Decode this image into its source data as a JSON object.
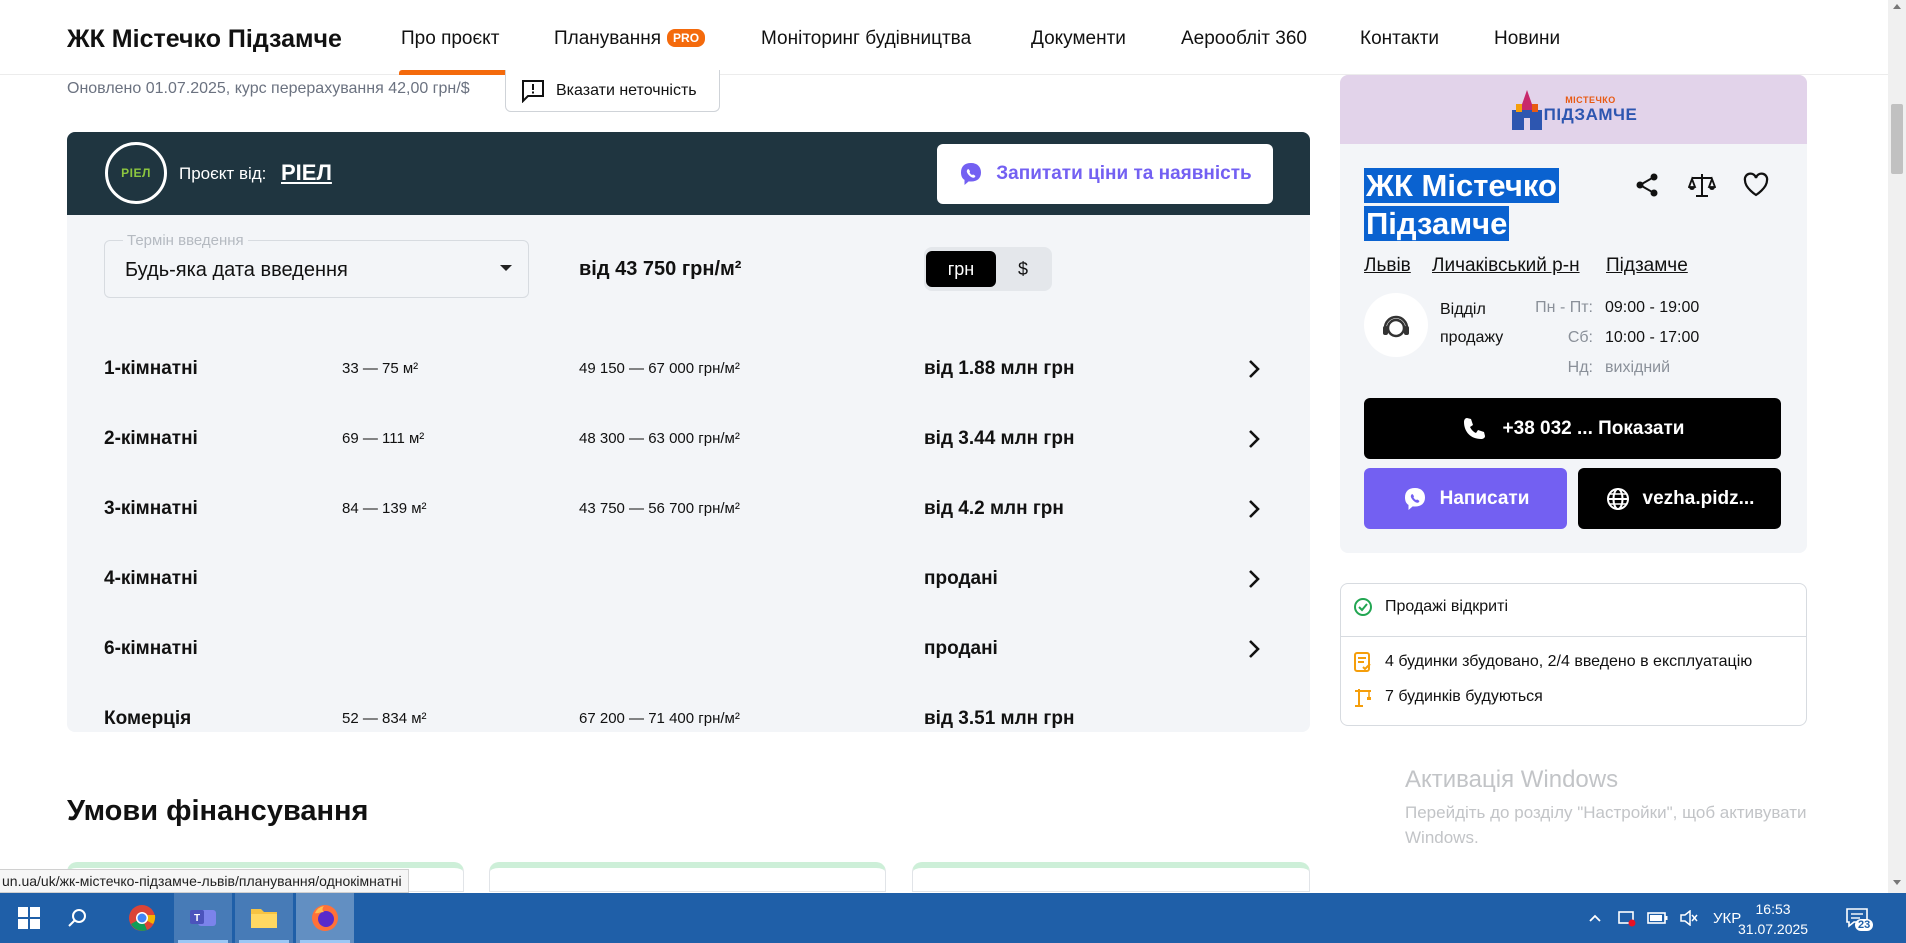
{
  "nav": {
    "brand": "ЖК Містечко Підзамче",
    "items": [
      {
        "label": "Про проєкт"
      },
      {
        "label": "Планування",
        "badge": "PRO"
      },
      {
        "label": "Моніторинг будівництва"
      },
      {
        "label": "Документи"
      },
      {
        "label": "Аерообліт 360"
      },
      {
        "label": "Контакти"
      },
      {
        "label": "Новини"
      }
    ],
    "active_index": 0,
    "accent_color": "#f46a0c"
  },
  "update_note": "Оновлено 01.07.2025, курс перерахування 42,00 грн/$",
  "report_button": "Вказати неточність",
  "project_card": {
    "developer_logo_text": "РІЕЛ",
    "project_by_label": "Проєкт від:",
    "developer_name": "РІЕЛ",
    "ask_button": "Запитати ціни та наявність",
    "date_filter": {
      "legend": "Термін введення",
      "value": "Будь-яка дата введення"
    },
    "price_from": "від 43 750 грн/м²",
    "currency": {
      "options": [
        "грн",
        "$"
      ],
      "selected": "грн"
    },
    "rows": [
      {
        "name": "1-кімнатні",
        "area": "33 — 75 м²",
        "price_per_m2": "49 150 — 67 000 грн/м²",
        "price": "від 1.88 млн грн"
      },
      {
        "name": "2-кімнатні",
        "area": "69 — 111 м²",
        "price_per_m2": "48 300 — 63 000 грн/м²",
        "price": "від 3.44 млн грн"
      },
      {
        "name": "3-кімнатні",
        "area": "84 — 139 м²",
        "price_per_m2": "43 750 — 56 700 грн/м²",
        "price": "від 4.2 млн грн"
      },
      {
        "name": "4-кімнатні",
        "area": "",
        "price_per_m2": "",
        "price": "продані"
      },
      {
        "name": "6-кімнатні",
        "area": "",
        "price_per_m2": "",
        "price": "продані"
      },
      {
        "name": "Комерція",
        "area": "52 — 834 м²",
        "price_per_m2": "67 200 — 71 400 грн/м²",
        "price": "від 3.51 млн грн"
      }
    ]
  },
  "finance": {
    "title": "Умови фінансування"
  },
  "sidebar": {
    "logo_small": "МІСТЕЧКО",
    "logo_big": "ПІДЗАМЧЕ",
    "title_line1": "ЖК Містечко",
    "title_line2": "Підзамче",
    "locations": [
      "Львів",
      "Личаківський р-н",
      "Підзамче"
    ],
    "sales_label_1": "Відділ",
    "sales_label_2": "продажу",
    "hours": [
      {
        "day": "Пн - Пт:",
        "time": "09:00 - 19:00"
      },
      {
        "day": "Сб:",
        "time": "10:00 - 17:00"
      },
      {
        "day": "Нд:",
        "time": "вихідний"
      }
    ],
    "phone_button": "+38 032 ... Показати",
    "write_button": "Написати",
    "site_button": "vezha.pidz...",
    "viber_color": "#7360f2"
  },
  "status": {
    "sales_open": "Продажі відкриті",
    "built": "4 будинки збудовано, 2/4 введено в експлуатацію",
    "building": "7 будинків будуються"
  },
  "windows_watermark": {
    "title": "Активація Windows",
    "text": "Перейдіть до розділу \"Настройки\", щоб активувати Windows."
  },
  "status_url": "un.ua/uk/жк-містечко-підзамче-львів/планування/однокімнатні",
  "taskbar": {
    "language": "УКР",
    "time": "16:53",
    "date": "31.07.2025",
    "notifications": "23"
  }
}
